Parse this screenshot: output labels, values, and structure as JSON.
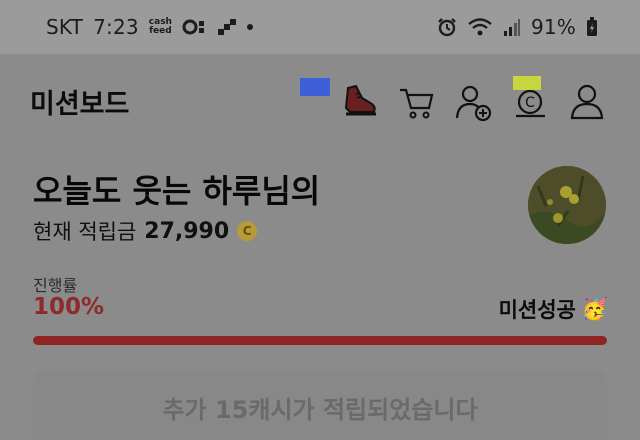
{
  "status_bar": {
    "carrier": "SKT",
    "time": "7:23",
    "cashfeed_line1": "cash",
    "cashfeed_line2": "feed",
    "battery": "91%"
  },
  "header": {
    "title": "미션보드",
    "icons": [
      "shoe-icon",
      "cart-icon",
      "add-friend-icon",
      "coin-icon",
      "profile-icon"
    ]
  },
  "user": {
    "name": "오늘도 웃는 하루님의",
    "balance_label": "현재 적립금",
    "balance_value": "27,990",
    "coin_symbol": "C"
  },
  "progress": {
    "label": "진행률",
    "value_text": "100%",
    "fraction": 1.0,
    "status": "미션성공",
    "status_emoji": "🥳"
  },
  "reward": {
    "message": "추가 15캐시가 적립되었습니다"
  },
  "colors": {
    "progress": "#8e2424",
    "coin": "#b99a3a"
  }
}
